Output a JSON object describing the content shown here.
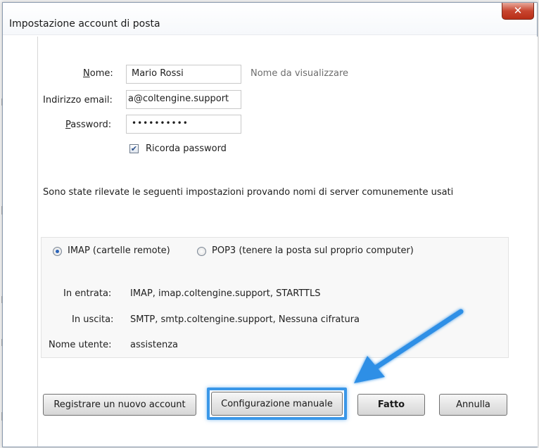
{
  "window": {
    "title": "Impostazione account di posta"
  },
  "form": {
    "name_label": "Nome:",
    "name_value": "Mario Rossi",
    "name_hint": "Nome da visualizzare",
    "email_label": "Indirizzo email:",
    "email_value": "a@coltengine.support",
    "password_label": "Password:",
    "password_value": "••••••••••",
    "remember_label": "Ricorda password",
    "remember_checked": true
  },
  "detected_text": "Sono state rilevate le seguenti impostazioni provando nomi di server comunemente usati",
  "protocol": {
    "imap_label": "IMAP (cartelle remote)",
    "pop3_label": "POP3 (tenere la posta sul proprio computer)",
    "selected": "imap"
  },
  "server": {
    "incoming_label": "In entrata:",
    "incoming_value": "IMAP, imap.coltengine.support, STARTTLS",
    "outgoing_label": "In uscita:",
    "outgoing_value": "SMTP, smtp.coltengine.support, Nessuna cifratura",
    "username_label": "Nome utente:",
    "username_value": "assistenza"
  },
  "buttons": {
    "register": "Registrare un nuovo account",
    "manual": "Configurazione manuale",
    "done": "Fatto",
    "cancel": "Annulla"
  },
  "colors": {
    "highlight": "#3a97e8",
    "close": "#c8452f"
  },
  "icons": {
    "close": "close-icon",
    "check": "checkmark-icon",
    "arrow": "annotation-arrow-icon"
  }
}
